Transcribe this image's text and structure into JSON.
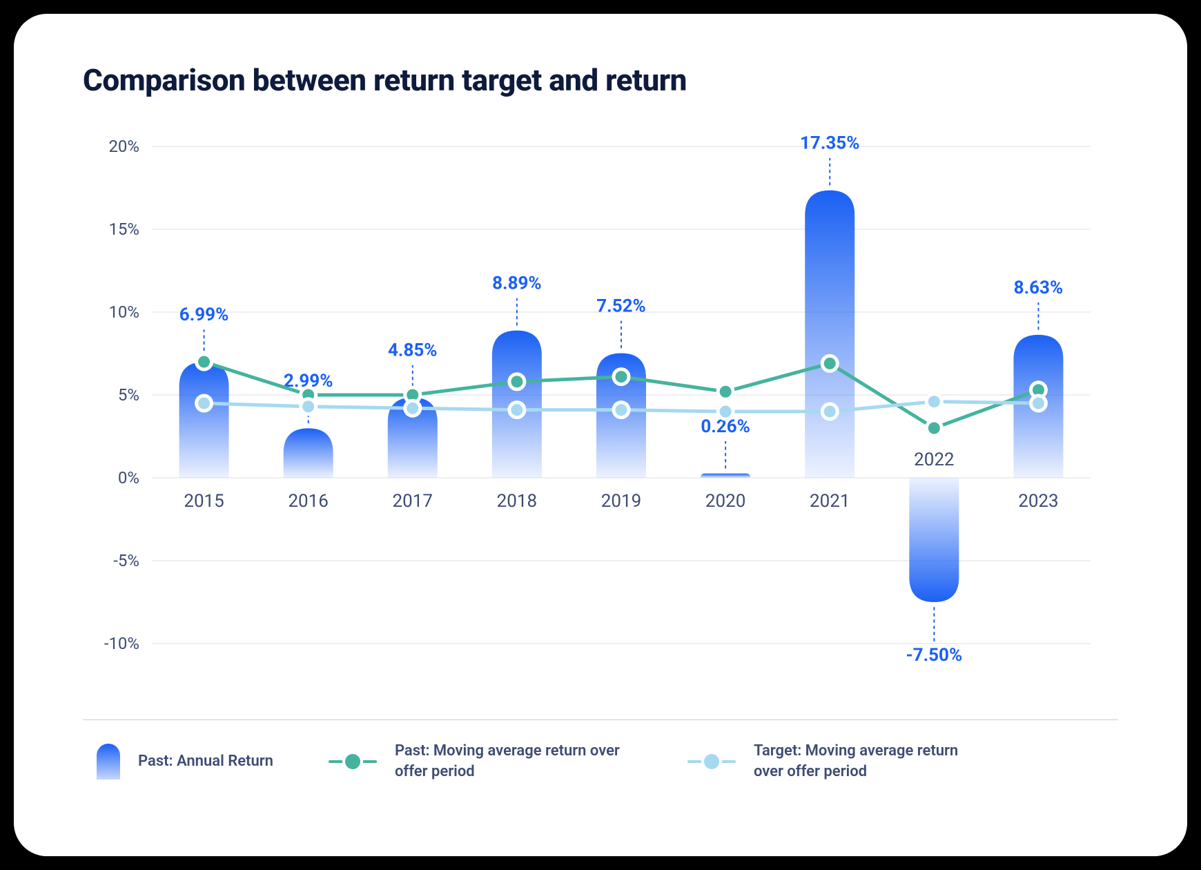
{
  "title": "Comparison between return target and return",
  "legend": {
    "bar": "Past: Annual Return",
    "line1": "Past: Moving average return over offer period",
    "line2": "Target: Moving average return over offer period"
  },
  "chart_data": {
    "type": "bar",
    "title": "Comparison between return target and return",
    "xlabel": "",
    "ylabel": "",
    "ylim": [
      -10,
      20
    ],
    "y_ticks": [
      "-10%",
      "-5%",
      "0%",
      "5%",
      "10%",
      "15%",
      "20%"
    ],
    "categories": [
      "2015",
      "2016",
      "2017",
      "2018",
      "2019",
      "2020",
      "2021",
      "2022",
      "2023"
    ],
    "series": [
      {
        "name": "Past: Annual Return",
        "kind": "bar",
        "color": "#1a60f4",
        "values": [
          6.99,
          2.99,
          4.85,
          8.89,
          7.52,
          0.26,
          17.35,
          -7.5,
          8.63
        ],
        "value_labels": [
          "6.99%",
          "2.99%",
          "4.85%",
          "8.89%",
          "7.52%",
          "0.26%",
          "17.35%",
          "-7.50%",
          "8.63%"
        ]
      },
      {
        "name": "Past: Moving average return over offer period",
        "kind": "line",
        "color": "#45b39d",
        "values": [
          7.0,
          5.0,
          5.0,
          5.8,
          6.1,
          5.2,
          6.9,
          3.0,
          5.3
        ]
      },
      {
        "name": "Target: Moving average return over offer period",
        "kind": "line",
        "color": "#a6d9f0",
        "values": [
          4.5,
          4.3,
          4.2,
          4.1,
          4.1,
          4.0,
          4.0,
          4.6,
          4.5
        ]
      }
    ]
  }
}
